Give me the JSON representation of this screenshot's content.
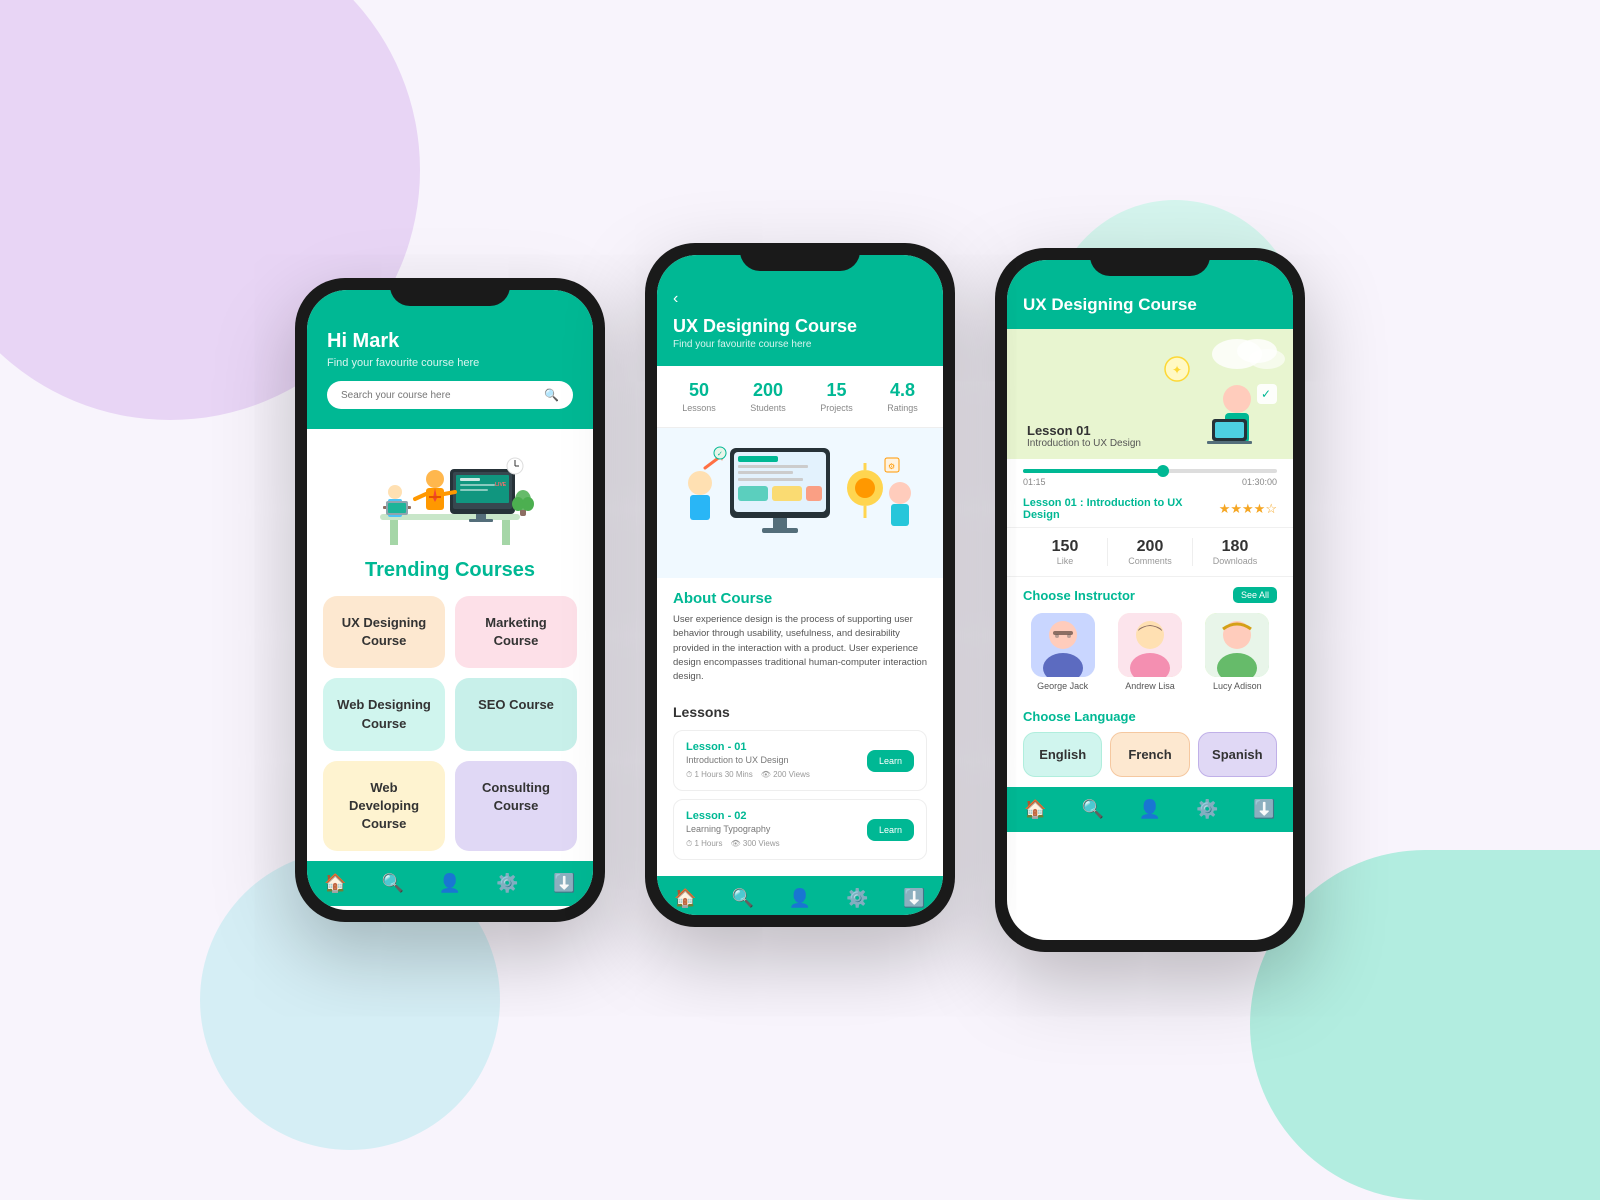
{
  "background": {
    "blob_colors": [
      "#e8d5f5",
      "#d5eef5",
      "#b2ede0",
      "#d5f5ee"
    ]
  },
  "phone1": {
    "header": {
      "greeting": "Hi Mark",
      "subtitle": "Find your favourite course here",
      "search_placeholder": "Search your course here"
    },
    "trending_title": "Trending Courses",
    "courses": [
      {
        "label": "UX Designing Course",
        "color_class": "peach"
      },
      {
        "label": "Marketing Course",
        "color_class": "pink"
      },
      {
        "label": "Web Designing Course",
        "color_class": "mint"
      },
      {
        "label": "SEO Course",
        "color_class": "teal-light"
      },
      {
        "label": "Web Developing Course",
        "color_class": "yellow"
      },
      {
        "label": "Consulting Course",
        "color_class": "lavender"
      }
    ],
    "nav_icons": [
      "🏠",
      "🔍",
      "👤",
      "⚙️",
      "⬇️"
    ]
  },
  "phone2": {
    "back_label": "‹",
    "title": "UX Designing Course",
    "subtitle": "Find your favourite course here",
    "stats": [
      {
        "num": "50",
        "label": "Lessons"
      },
      {
        "num": "200",
        "label": "Students"
      },
      {
        "num": "15",
        "label": "Projects"
      },
      {
        "num": "4.8",
        "label": "Ratings"
      }
    ],
    "about_title": "About Course",
    "about_text": "User experience design is the process of supporting user behavior through usability, usefulness, and desirability provided in the interaction with a product. User experience design encompasses traditional human-computer interaction design.",
    "lessons_title": "Lessons",
    "lessons": [
      {
        "name": "Lesson - 01",
        "sub": "Introduction to UX Design",
        "duration": "1 Hours 30 Mins",
        "views": "200 Views",
        "btn": "Learn"
      },
      {
        "name": "Lesson - 02",
        "sub": "Learning Typography",
        "duration": "1 Hours",
        "views": "300 Views",
        "btn": "Learn"
      }
    ],
    "nav_icons": [
      "🏠",
      "🔍",
      "👤",
      "⚙️",
      "⬇️"
    ]
  },
  "phone3": {
    "title": "UX Designing Course",
    "video": {
      "lesson_name": "Lesson 01",
      "lesson_sub": "Introduction to UX Design"
    },
    "progress": {
      "current_time": "01:15",
      "total_time": "01:30:00",
      "percent": 55
    },
    "lesson_title": "Lesson 01 : Introduction to UX Design",
    "stars": 4,
    "max_stars": 5,
    "engagement": [
      {
        "num": "150",
        "label": "Like"
      },
      {
        "num": "200",
        "label": "Comments"
      },
      {
        "num": "180",
        "label": "Downloads"
      }
    ],
    "instructor_title": "Choose Instructor",
    "see_all_label": "See All",
    "instructors": [
      {
        "name": "George Jack"
      },
      {
        "name": "Andrew Lisa"
      },
      {
        "name": "Lucy Adison"
      }
    ],
    "language_title": "Choose Language",
    "languages": [
      {
        "label": "English",
        "color_class": "mint-bg"
      },
      {
        "label": "French",
        "color_class": "peach-bg"
      },
      {
        "label": "Spanish",
        "color_class": "lavender-bg"
      }
    ],
    "nav_icons": [
      "🏠",
      "🔍",
      "👤",
      "⚙️",
      "⬇️"
    ]
  }
}
